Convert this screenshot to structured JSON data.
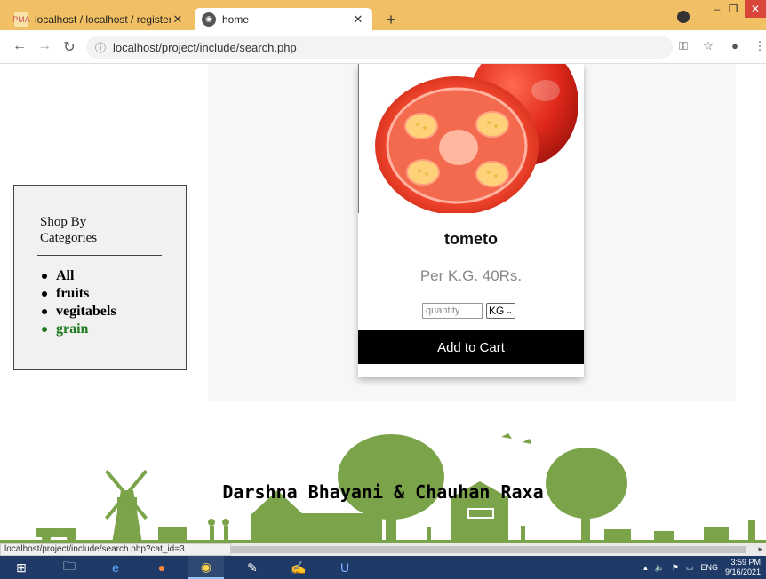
{
  "browser": {
    "tabs": [
      {
        "title": "localhost / localhost / register / s",
        "favicon": "phpmyadmin-icon",
        "active": false
      },
      {
        "title": "home",
        "favicon": "globe-icon",
        "active": true
      }
    ],
    "new_tab_label": "+",
    "url": "localhost/project/include/search.php",
    "status_url": "localhost/project/include/search.php?cat_id=3"
  },
  "sidebar": {
    "heading_line1": "Shop By",
    "heading_line2": "Categories",
    "items": [
      {
        "label": "All",
        "selected": false
      },
      {
        "label": "fruits",
        "selected": false
      },
      {
        "label": "vegitabels",
        "selected": false
      },
      {
        "label": "grain",
        "selected": true
      }
    ]
  },
  "product": {
    "name": "tometo",
    "price": "Per K.G. 40Rs.",
    "quantity_placeholder": "quantity",
    "unit_selected": "KG",
    "add_button": "Add to Cart"
  },
  "footer": {
    "credit": "Darshna Bhayani & Chauhan Raxa"
  },
  "taskbar": {
    "language": "ENG",
    "time": "3:59 PM",
    "date": "9/16/2021"
  },
  "colors": {
    "tab_strip": "#f2c064",
    "selected_category": "#1d7a1d",
    "footer_art": "#7aa34a",
    "cart_button": "#000000"
  }
}
